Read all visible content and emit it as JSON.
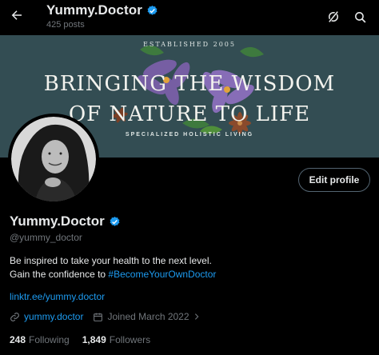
{
  "header": {
    "title": "Yummy.Doctor",
    "post_count": "425 posts",
    "back_icon": "arrow-left-icon",
    "grok_icon": "grok-icon",
    "search_icon": "search-icon"
  },
  "banner": {
    "established": "ESTABLISHED 2005",
    "line1": "BRINGING THE WISDOM",
    "line2": "OF NATURE TO LIFE",
    "tagline": "SPECIALIZED HOLISTIC LIVING",
    "colors": {
      "background": "#334d53",
      "flower": "#7a5fa8",
      "leaf": "#3e7a3e",
      "star_anise": "#8a4a2c"
    }
  },
  "profile": {
    "name": "Yummy.Doctor",
    "handle": "@yummy_doctor",
    "edit_label": "Edit profile",
    "bio_line1": "Be inspired to take your health to the next level.",
    "bio_line2_prefix": "Gain the confidence to ",
    "bio_hashtag": "#BecomeYourOwnDoctor",
    "link": "linktr.ee/yummy.doctor",
    "website": "yummy.doctor",
    "joined": "Joined March 2022",
    "following_count": "248",
    "following_label": "Following",
    "followers_count": "1,849",
    "followers_label": "Followers"
  },
  "colors": {
    "background": "#000000",
    "text": "#e7e9ea",
    "muted": "#71767b",
    "accent": "#1d9bf0",
    "verified": "#1d9bf0"
  }
}
